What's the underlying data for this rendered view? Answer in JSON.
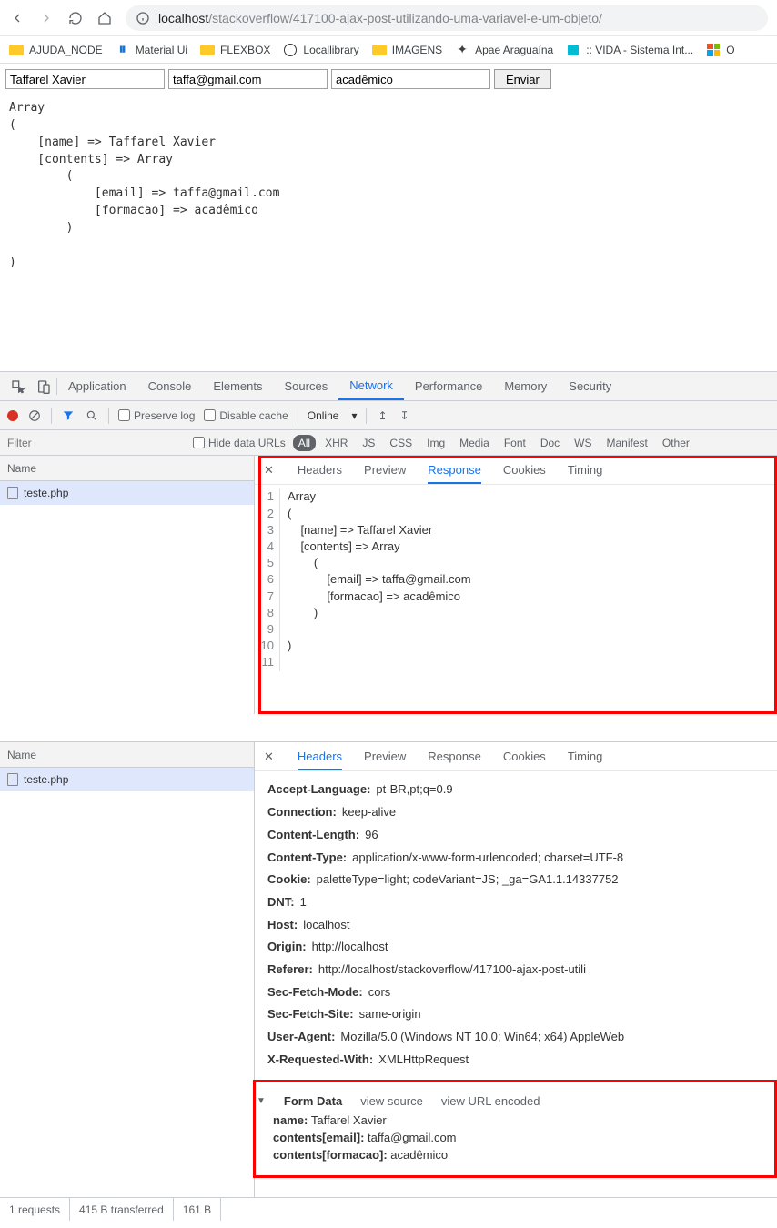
{
  "browser": {
    "url_host": "localhost",
    "url_path": "/stackoverflow/417100-ajax-post-utilizando-uma-variavel-e-um-objeto/"
  },
  "bookmarks": [
    {
      "label": "AJUDA_NODE",
      "icon": "folder"
    },
    {
      "label": "Material Ui",
      "icon": "mui"
    },
    {
      "label": "FLEXBOX",
      "icon": "folder"
    },
    {
      "label": "Locallibrary",
      "icon": "github"
    },
    {
      "label": "IMAGENS",
      "icon": "folder"
    },
    {
      "label": "Apae Araguaína",
      "icon": "apae"
    },
    {
      "label": ":: VIDA - Sistema Int...",
      "icon": "vida"
    },
    {
      "label": "O",
      "icon": "ms"
    }
  ],
  "form": {
    "name": "Taffarel Xavier",
    "email": "taffa@gmail.com",
    "role": "acadêmico",
    "submit": "Enviar"
  },
  "page_output": "Array\n(\n    [name] => Taffarel Xavier\n    [contents] => Array\n        (\n            [email] => taffa@gmail.com\n            [formacao] => acadêmico\n        )\n\n)",
  "devtools": {
    "tabs": [
      "Application",
      "Console",
      "Elements",
      "Sources",
      "Network",
      "Performance",
      "Memory",
      "Security"
    ],
    "active_tab": "Network",
    "preserve_log": "Preserve log",
    "disable_cache": "Disable cache",
    "online": "Online",
    "filter_placeholder": "Filter",
    "hide_data_urls": "Hide data URLs",
    "type_filters": [
      "All",
      "XHR",
      "JS",
      "CSS",
      "Img",
      "Media",
      "Font",
      "Doc",
      "WS",
      "Manifest",
      "Other"
    ],
    "active_type_filter": "All"
  },
  "panel1": {
    "name_col": "Name",
    "request": "teste.php",
    "detail_tabs": [
      "Headers",
      "Preview",
      "Response",
      "Cookies",
      "Timing"
    ],
    "active_detail": "Response",
    "line_numbers": [
      "1",
      "2",
      "3",
      "4",
      "5",
      "6",
      "7",
      "8",
      "9",
      "10",
      "11"
    ],
    "response_text": "Array\n(\n    [name] => Taffarel Xavier\n    [contents] => Array\n        (\n            [email] => taffa@gmail.com\n            [formacao] => acadêmico\n        )\n\n)\n"
  },
  "panel2": {
    "name_col": "Name",
    "request": "teste.php",
    "detail_tabs": [
      "Headers",
      "Preview",
      "Response",
      "Cookies",
      "Timing"
    ],
    "active_detail": "Headers",
    "headers": [
      {
        "k": "Accept-Language:",
        "v": "pt-BR,pt;q=0.9"
      },
      {
        "k": "Connection:",
        "v": "keep-alive"
      },
      {
        "k": "Content-Length:",
        "v": "96"
      },
      {
        "k": "Content-Type:",
        "v": "application/x-www-form-urlencoded; charset=UTF-8"
      },
      {
        "k": "Cookie:",
        "v": "paletteType=light; codeVariant=JS; _ga=GA1.1.14337752"
      },
      {
        "k": "DNT:",
        "v": "1"
      },
      {
        "k": "Host:",
        "v": "localhost"
      },
      {
        "k": "Origin:",
        "v": "http://localhost"
      },
      {
        "k": "Referer:",
        "v": "http://localhost/stackoverflow/417100-ajax-post-utili"
      },
      {
        "k": "Sec-Fetch-Mode:",
        "v": "cors"
      },
      {
        "k": "Sec-Fetch-Site:",
        "v": "same-origin"
      },
      {
        "k": "User-Agent:",
        "v": "Mozilla/5.0 (Windows NT 10.0; Win64; x64) AppleWeb"
      },
      {
        "k": "X-Requested-With:",
        "v": "XMLHttpRequest"
      }
    ],
    "form_data": {
      "title": "Form Data",
      "view_source": "view source",
      "view_url": "view URL encoded",
      "rows": [
        {
          "k": "name:",
          "v": "Taffarel Xavier"
        },
        {
          "k": "contents[email]:",
          "v": "taffa@gmail.com"
        },
        {
          "k": "contents[formacao]:",
          "v": "acadêmico"
        }
      ]
    }
  },
  "status": {
    "requests": "1 requests",
    "transferred": "415 B transferred",
    "resources": "161 B"
  }
}
